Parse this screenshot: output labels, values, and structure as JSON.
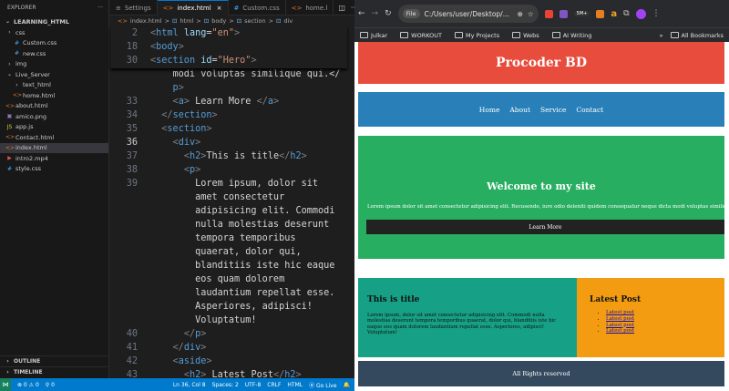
{
  "explorer": {
    "title": "EXPLORER",
    "more": "···",
    "project": "LEARNING_HTML",
    "items": [
      {
        "label": "css",
        "icon": "›",
        "indent": 6,
        "kind": "folder"
      },
      {
        "label": "Custom.css",
        "icon": "#",
        "indent": 14,
        "kind": "css"
      },
      {
        "label": "new.css",
        "icon": "#",
        "indent": 14,
        "kind": "css"
      },
      {
        "label": "img",
        "icon": "›",
        "indent": 6,
        "kind": "folder"
      },
      {
        "label": "Live_Server",
        "icon": "⌄",
        "indent": 6,
        "kind": "folder"
      },
      {
        "label": "text_html",
        "icon": "›",
        "indent": 14,
        "kind": "folder"
      },
      {
        "label": "home.html",
        "icon": "<>",
        "indent": 14,
        "kind": "html"
      },
      {
        "label": "about.html",
        "icon": "<>",
        "indent": 6,
        "kind": "html"
      },
      {
        "label": "amico.png",
        "icon": "▣",
        "indent": 6,
        "kind": "img"
      },
      {
        "label": "app.js",
        "icon": "JS",
        "indent": 6,
        "kind": "js"
      },
      {
        "label": "Contact.html",
        "icon": "<>",
        "indent": 6,
        "kind": "html"
      },
      {
        "label": "index.html",
        "icon": "<>",
        "indent": 6,
        "kind": "html"
      },
      {
        "label": "intro2.mp4",
        "icon": "▶",
        "indent": 6,
        "kind": "video"
      },
      {
        "label": "style.css",
        "icon": "#",
        "indent": 6,
        "kind": "css"
      }
    ],
    "outline": "OUTLINE",
    "timeline": "TIMELINE"
  },
  "tabs": [
    {
      "label": "Settings",
      "icon": "≡",
      "active": false
    },
    {
      "label": "index.html",
      "icon": "<>",
      "active": true
    },
    {
      "label": "Custom.css",
      "icon": "#",
      "active": false
    },
    {
      "label": "home.l",
      "icon": "<>",
      "active": false
    }
  ],
  "breadcrumb": {
    "file": "index.html",
    "sep": ">",
    "p1": "html",
    "p2": "body",
    "p3": "section",
    "p4": "div"
  },
  "statusbar": {
    "errors": "⊗ 0 ⚠ 0",
    "ports": "⚲ 0",
    "position": "Ln 36, Col 8",
    "spaces": "Spaces: 2",
    "encoding": "UTF-8",
    "eol": "CRLF",
    "language": "HTML",
    "golive": "⦿ Go Live",
    "bell": "🔔"
  },
  "browser": {
    "url": "C:/Users/user/Desktop/...",
    "file_chip": "File",
    "bookmarks": [
      "Julkar",
      "WORKOUT",
      "My Projects",
      "Webs",
      "AI Writing"
    ],
    "all_bookmarks": "All Bookmarks",
    "ext_badge": "5M+",
    "colors": {
      "ext1": "#ea4335",
      "ext2": "#7e57c2",
      "ext3": "#e67e22",
      "ext4": "#f5a623"
    }
  },
  "site": {
    "brand": "Procoder BD",
    "nav": [
      "Home",
      "About",
      "Service",
      "Contact"
    ],
    "hero_title": "Welcome to my site",
    "hero_text": "Lorem ipsum dolor sit amet consectetur adipisicing elit. Recusendo, iure odio deleniti quidem consequatur neque dicta modi voluptas similique qui.",
    "hero_button": "Learn More",
    "section_title": "This is title",
    "section_text": "Lorem ipsum, dolor sit amet consectetur adipisicing elit. Commodi nulla molestias deserunt tempora temporibus quaerat, dolor qui, blanditiis iste hic eaque eos quam dolorem laudantium repellat esse. Asperiores, adipisci! Voluptatum!",
    "aside_title": "Latest Post",
    "posts": [
      "Latest post",
      "Latest post",
      "Latest post",
      "Latest post"
    ],
    "footer": "All Rights reserved",
    "colors": {
      "header": "#e74c3c",
      "nav": "#2980b9",
      "hero": "#27ae60",
      "main": "#16a085",
      "aside": "#f39c12",
      "footer": "#34495e"
    }
  },
  "code": {
    "sticky": [
      {
        "num": "2",
        "parts": [
          [
            "t-p",
            "<"
          ],
          [
            "t",
            "html "
          ],
          [
            "a",
            "lang"
          ],
          [
            "w",
            "="
          ],
          [
            "s",
            "\"en\""
          ],
          [
            "t-p",
            ">"
          ]
        ]
      },
      {
        "num": "18",
        "parts": [
          [
            "t-p",
            "<"
          ],
          [
            "t",
            "body"
          ],
          [
            "t-p",
            ">"
          ]
        ]
      },
      {
        "num": "30",
        "parts": [
          [
            "t-p",
            "<"
          ],
          [
            "t",
            "section "
          ],
          [
            "a",
            "id"
          ],
          [
            "w",
            "="
          ],
          [
            "s",
            "\"Hero\""
          ],
          [
            "t-p",
            ">"
          ]
        ]
      }
    ],
    "lines": [
      {
        "num": "",
        "parts": [
          [
            "w",
            "    modi voluptas similique qui.</"
          ]
        ]
      },
      {
        "num": "",
        "parts": [
          [
            "w",
            "    "
          ],
          [
            "t",
            "p"
          ],
          [
            "t-p",
            ">"
          ]
        ]
      },
      {
        "num": "33",
        "parts": [
          [
            "w",
            "    "
          ],
          [
            "t-p",
            "<"
          ],
          [
            "t",
            "a"
          ],
          [
            "t-p",
            ">"
          ],
          [
            "w",
            " Learn More "
          ],
          [
            "t-p",
            "</"
          ],
          [
            "t",
            "a"
          ],
          [
            "t-p",
            ">"
          ]
        ]
      },
      {
        "num": "34",
        "parts": [
          [
            "w",
            "  "
          ],
          [
            "t-p",
            "</"
          ],
          [
            "t",
            "section"
          ],
          [
            "t-p",
            ">"
          ]
        ]
      },
      {
        "num": "35",
        "parts": [
          [
            "w",
            "  "
          ],
          [
            "t-p",
            "<"
          ],
          [
            "t",
            "section"
          ],
          [
            "t-p",
            ">"
          ]
        ]
      },
      {
        "num": "36",
        "cur": true,
        "parts": [
          [
            "w",
            "    "
          ],
          [
            "t-p",
            "<"
          ],
          [
            "t",
            "div"
          ],
          [
            "t-p",
            ">"
          ]
        ]
      },
      {
        "num": "37",
        "parts": [
          [
            "w",
            "      "
          ],
          [
            "t-p",
            "<"
          ],
          [
            "t",
            "h2"
          ],
          [
            "t-p",
            ">"
          ],
          [
            "w",
            "This is title"
          ],
          [
            "t-p",
            "</"
          ],
          [
            "t",
            "h2"
          ],
          [
            "t-p",
            ">"
          ]
        ]
      },
      {
        "num": "38",
        "parts": [
          [
            "w",
            "      "
          ],
          [
            "t-p",
            "<"
          ],
          [
            "t",
            "p"
          ],
          [
            "t-p",
            ">"
          ]
        ]
      },
      {
        "num": "39",
        "parts": [
          [
            "w",
            "        Lorem ipsum, dolor sit"
          ]
        ]
      },
      {
        "num": "",
        "parts": [
          [
            "w",
            "        amet consectetur"
          ]
        ]
      },
      {
        "num": "",
        "parts": [
          [
            "w",
            "        adipisicing elit. Commodi"
          ]
        ]
      },
      {
        "num": "",
        "parts": [
          [
            "w",
            "        nulla molestias deserunt"
          ]
        ]
      },
      {
        "num": "",
        "parts": [
          [
            "w",
            "        tempora temporibus"
          ]
        ]
      },
      {
        "num": "",
        "parts": [
          [
            "w",
            "        quaerat, dolor qui,"
          ]
        ]
      },
      {
        "num": "",
        "parts": [
          [
            "w",
            "        blanditiis iste hic eaque"
          ]
        ]
      },
      {
        "num": "",
        "parts": [
          [
            "w",
            "        eos quam dolorem"
          ]
        ]
      },
      {
        "num": "",
        "parts": [
          [
            "w",
            "        laudantium repellat esse."
          ]
        ]
      },
      {
        "num": "",
        "parts": [
          [
            "w",
            "        Asperiores, adipisci!"
          ]
        ]
      },
      {
        "num": "",
        "parts": [
          [
            "w",
            "        Voluptatum!"
          ]
        ]
      },
      {
        "num": "40",
        "parts": [
          [
            "w",
            "      "
          ],
          [
            "t-p",
            "</"
          ],
          [
            "t",
            "p"
          ],
          [
            "t-p",
            ">"
          ]
        ]
      },
      {
        "num": "41",
        "parts": [
          [
            "w",
            "    "
          ],
          [
            "t-p",
            "</"
          ],
          [
            "t",
            "div"
          ],
          [
            "t-p",
            ">"
          ]
        ]
      },
      {
        "num": "42",
        "parts": [
          [
            "w",
            "    "
          ],
          [
            "t-p",
            "<"
          ],
          [
            "t",
            "aside"
          ],
          [
            "t-p",
            ">"
          ]
        ]
      },
      {
        "num": "43",
        "parts": [
          [
            "w",
            "      "
          ],
          [
            "t-p",
            "<"
          ],
          [
            "t",
            "h2"
          ],
          [
            "t-p",
            ">"
          ],
          [
            "w",
            " Latest Post"
          ],
          [
            "t-p",
            "</"
          ],
          [
            "t",
            "h2"
          ],
          [
            "t-p",
            ">"
          ]
        ]
      }
    ]
  }
}
